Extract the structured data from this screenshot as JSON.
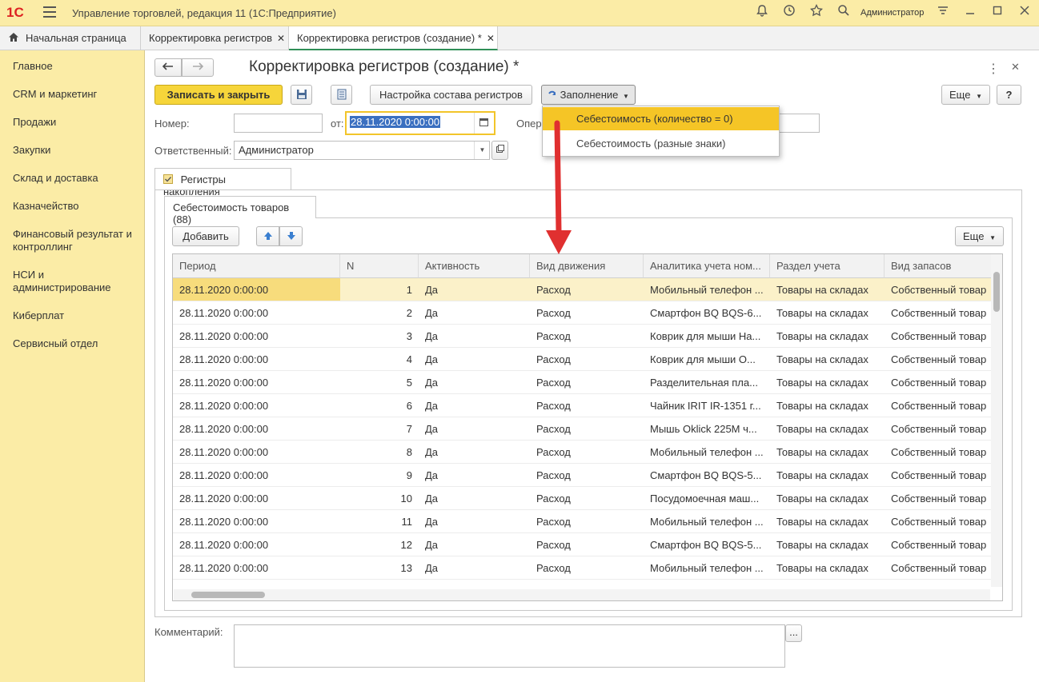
{
  "app": {
    "logo": "1С",
    "title": "Управление торговлей, редакция 11  (1С:Предприятие)",
    "user": "Администратор"
  },
  "tabs": [
    {
      "label": "Начальная страница"
    },
    {
      "label": "Корректировка регистров"
    },
    {
      "label": "Корректировка регистров (создание) *"
    }
  ],
  "sidebar": {
    "items": [
      "Главное",
      "CRM и маркетинг",
      "Продажи",
      "Закупки",
      "Склад и доставка",
      "Казначейство",
      "Финансовый результат и контроллинг",
      "НСИ и администрирование",
      "Киберплат",
      "Сервисный отдел"
    ]
  },
  "form": {
    "title": "Корректировка регистров (создание) *",
    "save_close": "Записать и закрыть",
    "settings_btn": "Настройка состава регистров",
    "fill_btn": "Заполнение",
    "more_btn": "Еще",
    "help_btn": "?",
    "number_label": "Номер:",
    "number_value": "",
    "date_label": "от:",
    "date_value": "28.11.2020  0:00:00",
    "oper_label": "Опер",
    "resp_label": "Ответственный:",
    "resp_value": "Администратор",
    "comment_label": "Комментарий:",
    "comment_btn": "..."
  },
  "dropdown": {
    "items": [
      "Себестоимость (количество = 0)",
      "Себестоимость (разные знаки)"
    ]
  },
  "panels": {
    "reg_tab": "Регистры накопления",
    "inner_tab": "Себестоимость товаров (88)",
    "add_btn": "Добавить",
    "more_btn": "Еще"
  },
  "table": {
    "columns": [
      "Период",
      "N",
      "Активность",
      "Вид движения",
      "Аналитика учета ном...",
      "Раздел учета",
      "Вид запасов"
    ],
    "rows": [
      [
        "28.11.2020 0:00:00",
        "1",
        "Да",
        "Расход",
        "Мобильный телефон ...",
        "Товары на складах",
        "Собственный товар"
      ],
      [
        "28.11.2020 0:00:00",
        "2",
        "Да",
        "Расход",
        "Смартфон BQ BQS-6...",
        "Товары на складах",
        "Собственный товар"
      ],
      [
        "28.11.2020 0:00:00",
        "3",
        "Да",
        "Расход",
        "Коврик для мыши На...",
        "Товары на складах",
        "Собственный товар"
      ],
      [
        "28.11.2020 0:00:00",
        "4",
        "Да",
        "Расход",
        "Коврик для мыши О...",
        "Товары на складах",
        "Собственный товар"
      ],
      [
        "28.11.2020 0:00:00",
        "5",
        "Да",
        "Расход",
        "Разделительная пла...",
        "Товары на складах",
        "Собственный товар"
      ],
      [
        "28.11.2020 0:00:00",
        "6",
        "Да",
        "Расход",
        "Чайник IRIT IR-1351 г...",
        "Товары на складах",
        "Собственный товар"
      ],
      [
        "28.11.2020 0:00:00",
        "7",
        "Да",
        "Расход",
        "Мышь Oklick 225M ч...",
        "Товары на складах",
        "Собственный товар"
      ],
      [
        "28.11.2020 0:00:00",
        "8",
        "Да",
        "Расход",
        "Мобильный телефон ...",
        "Товары на складах",
        "Собственный товар"
      ],
      [
        "28.11.2020 0:00:00",
        "9",
        "Да",
        "Расход",
        "Смартфон BQ BQS-5...",
        "Товары на складах",
        "Собственный товар"
      ],
      [
        "28.11.2020 0:00:00",
        "10",
        "Да",
        "Расход",
        "Посудомоечная маш...",
        "Товары на складах",
        "Собственный товар"
      ],
      [
        "28.11.2020 0:00:00",
        "11",
        "Да",
        "Расход",
        "Мобильный телефон ...",
        "Товары на складах",
        "Собственный товар"
      ],
      [
        "28.11.2020 0:00:00",
        "12",
        "Да",
        "Расход",
        "Смартфон BQ BQS-5...",
        "Товары на складах",
        "Собственный товар"
      ],
      [
        "28.11.2020 0:00:00",
        "13",
        "Да",
        "Расход",
        "Мобильный телефон ...",
        "Товары на складах",
        "Собственный товар"
      ]
    ]
  },
  "colors": {
    "accent": "#f6d53a",
    "sidebar_bg": "#fbeca6",
    "selection": "#f5c526",
    "arrow": "#e03030"
  }
}
